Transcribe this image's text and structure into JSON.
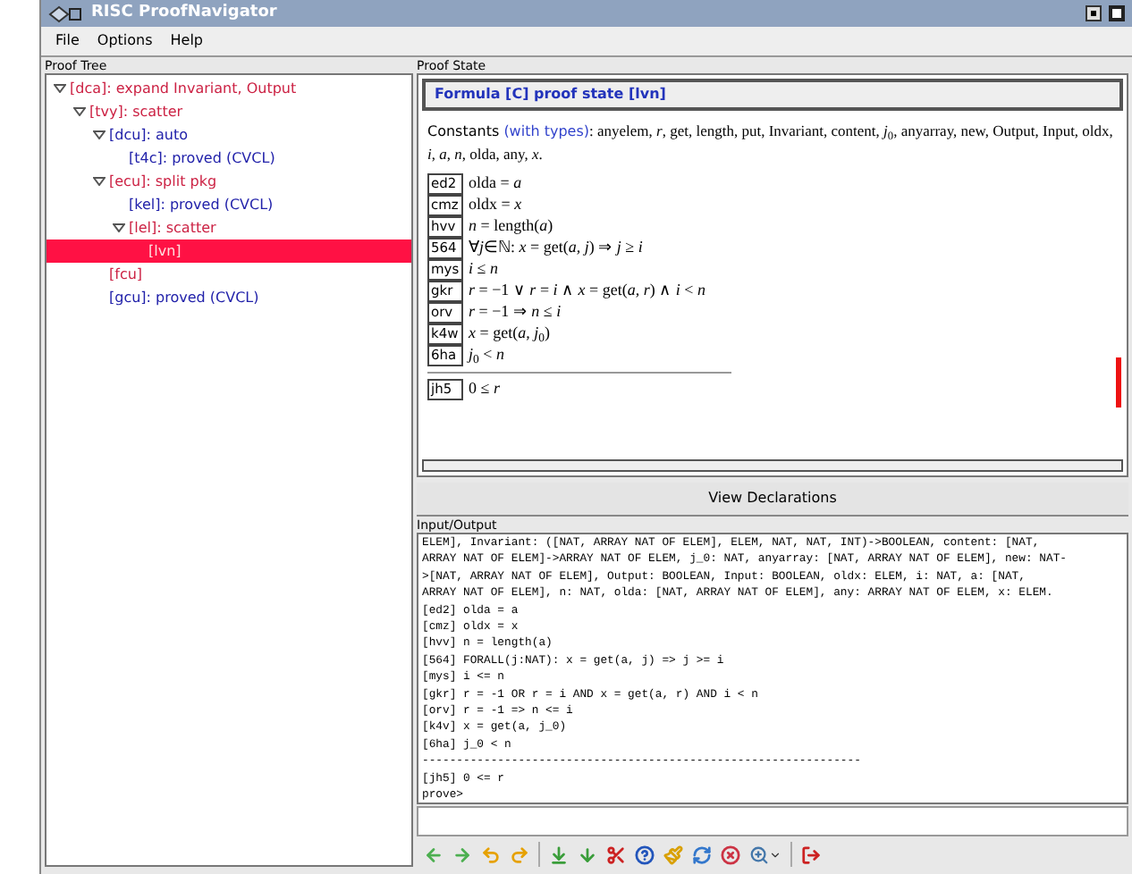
{
  "window": {
    "title": "RISC ProofNavigator"
  },
  "menu": [
    "File",
    "Options",
    "Help"
  ],
  "proof_tree": {
    "title": "Proof Tree",
    "nodes": [
      {
        "label": "[dca]: expand Invariant, Output",
        "color": "#cc2244",
        "selected": false,
        "children": [
          {
            "label": "[tvy]: scatter",
            "color": "#cc2244",
            "selected": false,
            "children": [
              {
                "label": "[dcu]: auto",
                "color": "#2222aa",
                "selected": false,
                "children": [
                  {
                    "label": "[t4c]: proved (CVCL)",
                    "color": "#2222aa",
                    "selected": false
                  }
                ]
              },
              {
                "label": "[ecu]: split pkg",
                "color": "#cc2244",
                "selected": false,
                "children": [
                  {
                    "label": "[kel]: proved (CVCL)",
                    "color": "#2222aa",
                    "selected": false
                  },
                  {
                    "label": "[lel]: scatter",
                    "color": "#cc2244",
                    "selected": false,
                    "children": [
                      {
                        "label": "[lvn]",
                        "selected": true
                      }
                    ]
                  }
                ]
              },
              {
                "label": "[fcu]",
                "color": "#cc2244",
                "selected": false
              },
              {
                "label": "[gcu]: proved (CVCL)",
                "color": "#2222aa",
                "selected": false
              }
            ]
          }
        ]
      }
    ]
  },
  "proof_state": {
    "title": "Proof State",
    "header": "Formula [C] proof state [lvn]",
    "constants_label": "Constants",
    "types_link": "(with types)",
    "constants": ": anyelem, *r*, get, length, put, Invariant, content, *j*$_{0}$, anyarray, new, Output, Input, oldx, *i*, *a*, *n*, olda, any, *x*.",
    "hypotheses": [
      {
        "label": "ed2",
        "formula": "olda = *a*"
      },
      {
        "label": "cmz",
        "formula": "oldx = *x*"
      },
      {
        "label": "hvv",
        "formula": "*n* = length(*a*)"
      },
      {
        "label": "564",
        "formula": "∀*j*∈ℕ: *x* = get(*a*, *j*) ⇒ *j* ≥ *i*"
      },
      {
        "label": "mys",
        "formula": "*i* ≤ *n*"
      },
      {
        "label": "gkr",
        "formula": "*r* = −1 ∨ *r* = *i* ∧ *x* = get(*a*, *r*) ∧ *i* < *n*"
      },
      {
        "label": "orv",
        "formula": "*r* = −1 ⇒ *n* ≤ *i*"
      },
      {
        "label": "k4w",
        "formula": "*x* = get(*a*, *j*$_{0}$)"
      },
      {
        "label": "6ha",
        "formula": "*j*$_{0}$ < *n*"
      }
    ],
    "goal": {
      "label": "jh5",
      "formula": "0 ≤ *r*"
    }
  },
  "view_declarations_button": "View Declarations",
  "io": {
    "title": "Input/Output",
    "lines": [
      "ELEM], Invariant: ([NAT, ARRAY NAT OF ELEM], ELEM, NAT, NAT, INT)->BOOLEAN, content: [NAT,",
      "ARRAY NAT OF ELEM]->ARRAY NAT OF ELEM, j_0: NAT, anyarray: [NAT, ARRAY NAT OF ELEM], new: NAT-",
      ">[NAT, ARRAY NAT OF ELEM], Output: BOOLEAN, Input: BOOLEAN, oldx: ELEM, i: NAT, a: [NAT,",
      "ARRAY NAT OF ELEM], n: NAT, olda: [NAT, ARRAY NAT OF ELEM], any: ARRAY NAT OF ELEM, x: ELEM.",
      "[ed2] olda = a",
      "[cmz] oldx = x",
      "[hvv] n = length(a)",
      "[564] FORALL(j:NAT): x = get(a, j) => j >= i",
      "[mys] i <= n",
      "[gkr] r = -1 OR r = i AND x = get(a, r) AND i < n",
      "[orv] r = -1 => n <= i",
      "[k4v] x = get(a, j_0)",
      "[6ha] j_0 < n",
      "----------------------------------------------------------------",
      "[jh5] 0 <= r",
      "prove>"
    ]
  }
}
